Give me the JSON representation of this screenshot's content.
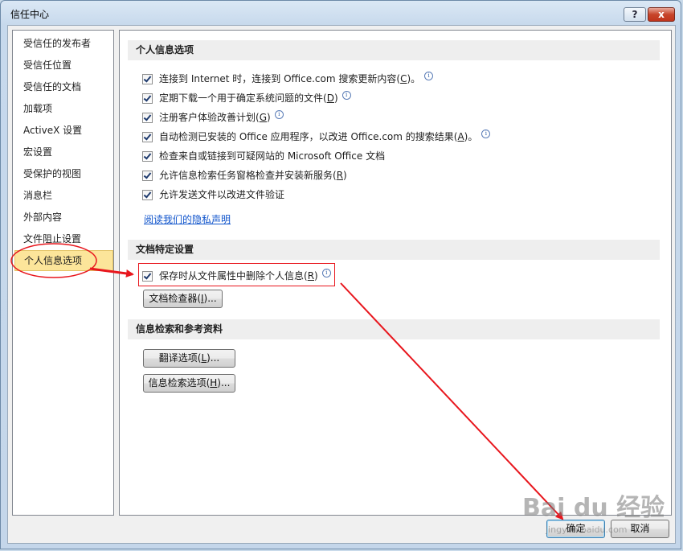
{
  "window": {
    "title": "信任中心",
    "help_label": "?",
    "close_label": "x"
  },
  "sidebar": {
    "items": [
      {
        "label": "受信任的发布者"
      },
      {
        "label": "受信任位置"
      },
      {
        "label": "受信任的文档"
      },
      {
        "label": "加载项"
      },
      {
        "label": "ActiveX 设置"
      },
      {
        "label": "宏设置"
      },
      {
        "label": "受保护的视图"
      },
      {
        "label": "消息栏"
      },
      {
        "label": "外部内容"
      },
      {
        "label": "文件阻止设置"
      },
      {
        "label": "个人信息选项"
      }
    ],
    "selected_index": 10
  },
  "privacy": {
    "heading": "个人信息选项",
    "options": [
      {
        "pre": "连接到 Internet 时，连接到 Office.com 搜索更新内容(",
        "key": "C",
        "post": ")。",
        "checked": true,
        "info": true
      },
      {
        "pre": "定期下载一个用于确定系统问题的文件(",
        "key": "D",
        "post": ")",
        "checked": true,
        "info": true
      },
      {
        "pre": "注册客户体验改善计划(",
        "key": "G",
        "post": ")",
        "checked": true,
        "info": true
      },
      {
        "pre": "自动检测已安装的 Office 应用程序，以改进 Office.com 的搜索结果(",
        "key": "A",
        "post": ")。",
        "checked": true,
        "info": true
      },
      {
        "pre": "检查来自或链接到可疑网站的 Microsoft Office 文档",
        "key": "",
        "post": "",
        "checked": true,
        "info": false
      },
      {
        "pre": "允许信息检索任务窗格检查并安装新服务(",
        "key": "R",
        "post": ")",
        "checked": true,
        "info": false
      },
      {
        "pre": "允许发送文件以改进文件验证",
        "key": "",
        "post": "",
        "checked": true,
        "info": false
      }
    ],
    "link": "阅读我们的隐私声明"
  },
  "document": {
    "heading": "文档特定设置",
    "option": {
      "pre": "保存时从文件属性中删除个人信息(",
      "key": "R",
      "post": ")",
      "checked": true,
      "info": true
    },
    "inspector_button": {
      "pre": "文档检查器(",
      "key": "I",
      "post": ")..."
    }
  },
  "research": {
    "heading": "信息检索和参考资料",
    "translate_button": {
      "pre": "翻译选项(",
      "key": "L",
      "post": ")..."
    },
    "research_button": {
      "pre": "信息检索选项(",
      "key": "H",
      "post": ")..."
    }
  },
  "footer": {
    "ok_label": "确定",
    "cancel_label": "取消"
  },
  "watermark": {
    "logo": "Bai du 经验",
    "url": "jingyan.baidu.com"
  },
  "annotation_color": "#e8161d",
  "selection_color": "#fce59a"
}
